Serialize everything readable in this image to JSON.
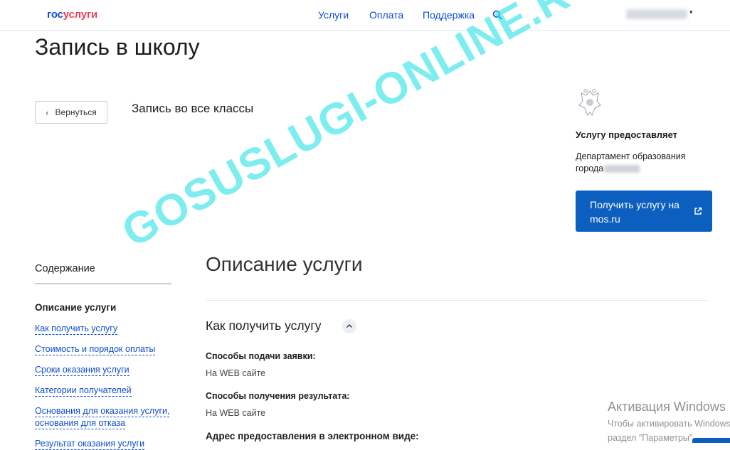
{
  "header": {
    "logo_part1": "гос",
    "logo_part2": "услуги",
    "nav": [
      {
        "label": "Услуги"
      },
      {
        "label": "Оплата"
      },
      {
        "label": "Поддержка"
      }
    ],
    "search_icon": "search-icon",
    "user_menu_caret": "▾"
  },
  "page": {
    "title": "Запись в школу",
    "back_button": "Вернуться",
    "subtitle": "Запись во все классы"
  },
  "provider": {
    "icon": "emblem-icon",
    "heading": "Услугу предоставляет",
    "name_line1": "Департамент образования",
    "name_line2": "города",
    "action_button": "Получить услугу на mos.ru",
    "action_icon": "external-link-icon"
  },
  "toc": {
    "title": "Содержание",
    "active": "Описание услуги",
    "links": [
      "Как получить услугу",
      "Стоимость и порядок оплаты",
      "Сроки оказания услуги",
      "Категории получателей",
      "Основания для оказания услуги,",
      "основания для отказа",
      "Результат оказания услуги"
    ]
  },
  "content": {
    "section_title": "Описание услуги",
    "subsection_title": "Как получить услугу",
    "fields": [
      {
        "label": "Способы подачи заявки:",
        "value": "На WEB сайте"
      },
      {
        "label": "Способы получения результата:",
        "value": "На WEB сайте"
      },
      {
        "label": "Адрес предоставления в электронном виде:"
      }
    ]
  },
  "watermark": "GOSUSLUGI-ONLINE.RU",
  "windows_activation": {
    "title": "Активация Windows",
    "line1": "Чтобы активировать Windows,",
    "line2": "раздел \"Параметры\"."
  },
  "colors": {
    "brand_blue": "#0d4cd3",
    "brand_red": "#ee3f58",
    "button_blue": "#0d5fbf",
    "watermark": "#2fe3e8"
  }
}
